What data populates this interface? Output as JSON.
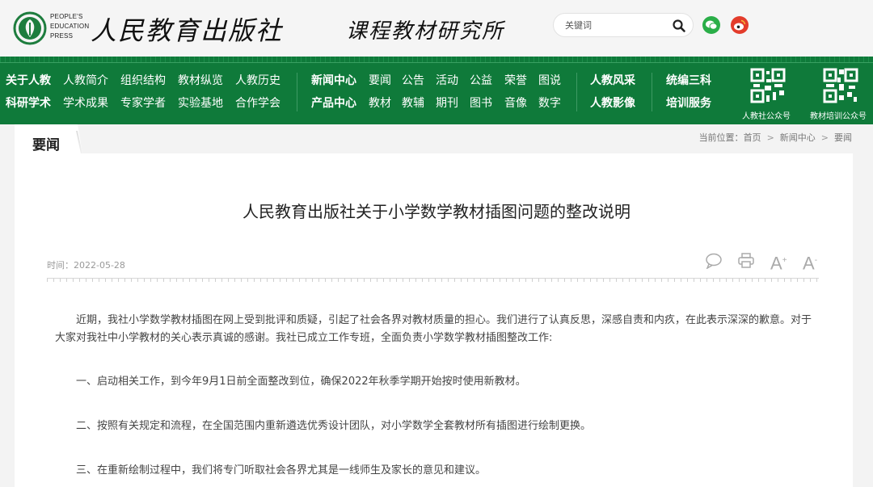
{
  "header": {
    "logo_en": [
      "PEOPLE'S",
      "EDUCATION",
      "PRESS"
    ],
    "brand_name": "人民教育出版社",
    "sub_brand": "课程教材研究所",
    "search": {
      "placeholder": "关键词"
    },
    "social": [
      "wechat-icon",
      "weibo-icon"
    ]
  },
  "nav": {
    "row1": [
      "关于人教",
      "人教简介",
      "组织结构",
      "教材纵览",
      "人教历史",
      "新闻中心",
      "要闻",
      "公告",
      "活动",
      "公益",
      "荣誉",
      "图说",
      "人教风采",
      "统编三科"
    ],
    "row2": [
      "科研学术",
      "学术成果",
      "专家学者",
      "实验基地",
      "合作学会",
      "产品中心",
      "教材",
      "教辅",
      "期刊",
      "图书",
      "音像",
      "数字",
      "人教影像",
      "培训服务"
    ],
    "qr": [
      "人教社公众号",
      "教材培训公众号"
    ]
  },
  "section": {
    "tab": "要闻",
    "breadcrumb_prefix": "当前位置：",
    "breadcrumb": [
      "首页",
      "新闻中心",
      "要闻"
    ],
    "breadcrumb_sep": ">"
  },
  "article": {
    "title": "人民教育出版社关于小学数学教材插图问题的整改说明",
    "time": "时间：2022-05-28",
    "tools": {
      "font_up": "A",
      "font_down": "A"
    },
    "paragraphs": [
      "近期，我社小学数学教材插图在网上受到批评和质疑，引起了社会各界对教材质量的担心。我们进行了认真反思，深感自责和内疚，在此表示深深的歉意。对于大家对我社中小学教材的关心表示真诚的感谢。我社已成立工作专班，全面负责小学数学教材插图整改工作:",
      "一、启动相关工作，到今年9月1日前全面整改到位，确保2022年秋季学期开始按时使用新教材。",
      "二、按照有关规定和流程，在全国范围内重新遴选优秀设计团队，对小学数学全套教材所有插图进行绘制更换。",
      "三、在重新绘制过程中，我们将专门听取社会各界尤其是一线师生及家长的意见和建议。"
    ]
  },
  "colors": {
    "nav_green": "#0f7a3a",
    "wechat": "#2aae48",
    "weibo": "#e33c2b"
  }
}
